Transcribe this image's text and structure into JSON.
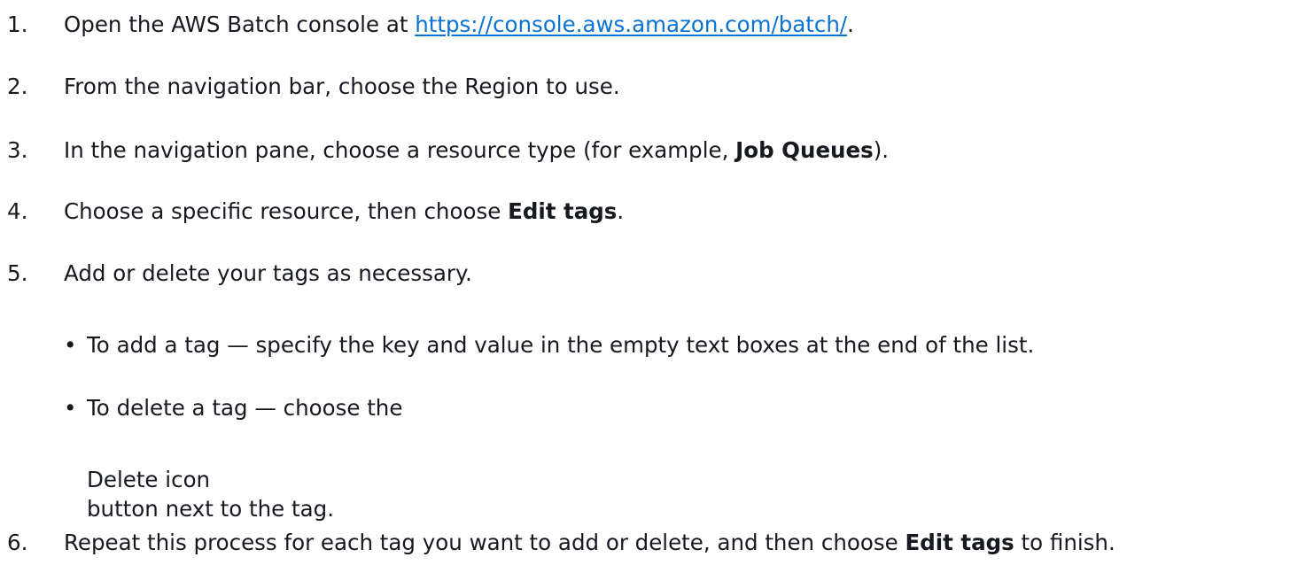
{
  "steps": [
    {
      "num": "1.",
      "before": "Open the AWS Batch console at ",
      "link": "https://console.aws.amazon.com/batch/",
      "after": "."
    },
    {
      "num": "2.",
      "text": "From the navigation bar, choose the Region to use."
    },
    {
      "num": "3.",
      "before": "In the navigation pane, choose a resource type (for example, ",
      "bold": "Job Queues",
      "after": ")."
    },
    {
      "num": "4.",
      "before": "Choose a specific resource, then choose ",
      "bold": "Edit tags",
      "after": "."
    },
    {
      "num": "5.",
      "text": "Add or delete your tags as necessary.",
      "bullets": [
        {
          "dot": "•",
          "text": "To add a tag — specify the key and value in the empty text boxes at the end of the list."
        },
        {
          "dot": "•",
          "text": "To delete a tag — choose the",
          "icon_alt": "Delete icon",
          "after": "button next to the tag."
        }
      ]
    },
    {
      "num": "6.",
      "before": "Repeat this process for each tag you want to add or delete, and then choose ",
      "bold": "Edit tags",
      "after": " to finish."
    }
  ]
}
